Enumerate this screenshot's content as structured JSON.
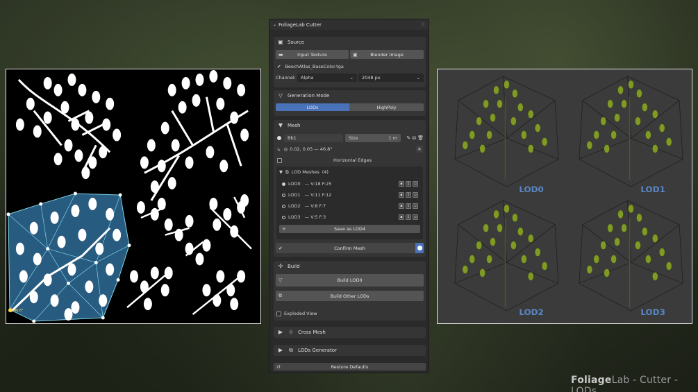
{
  "panel": {
    "title": "FoliageLab Cutter",
    "source": {
      "title": "Source",
      "input_texture": "Input Texture",
      "blender_image": "Blender Image",
      "file_name": "BeechAtlas_BaseColor.tga",
      "channel_label": "Channel:",
      "channel_value": "Alpha",
      "resolution_value": "2048 px"
    },
    "generation": {
      "title": "Generation Mode",
      "tab_lods": "LODs",
      "tab_highpoly": "HighPoly"
    },
    "mesh": {
      "title": "Mesh",
      "name": "Bb1",
      "size_label": "Size",
      "size_value": "1 m",
      "coords": "0.02, 0.05 — 46.8°",
      "horizontal_edges": "Horizontal Edges",
      "lod_meshes_title": "LOD Meshes",
      "lod_meshes_count": "(4)",
      "lods": [
        {
          "name": "LOD0",
          "stats": "— V:18  F:25"
        },
        {
          "name": "LOD1",
          "stats": "— V:11  F:12"
        },
        {
          "name": "LOD2",
          "stats": "— V:8  F:7"
        },
        {
          "name": "LOD3",
          "stats": "— V:5  F:3"
        }
      ],
      "save_as_lod": "Save as LOD4",
      "confirm_mesh": "Confirm Mesh"
    },
    "build": {
      "title": "Build",
      "build_lod0": "Build LOD0",
      "build_other": "Build Other LODs",
      "exploded_view": "Exploded View"
    },
    "cross_mesh": "Cross Mesh",
    "lods_generator": "LODs Generator",
    "restore_defaults": "Restore Defaults"
  },
  "preview": {
    "labels": [
      "LOD0",
      "LOD1",
      "LOD2",
      "LOD3"
    ]
  },
  "atlas": {
    "angle_label": "46.8°"
  },
  "footer": {
    "brand_bold": "Foliage",
    "brand_rest": "Lab - Cutter - LODs"
  },
  "colors": {
    "accent_blue": "#4a72b8",
    "lod_label": "#5b86c4",
    "mesh_fill": "#2f6b96",
    "leaf_green": "#6f8a22"
  }
}
